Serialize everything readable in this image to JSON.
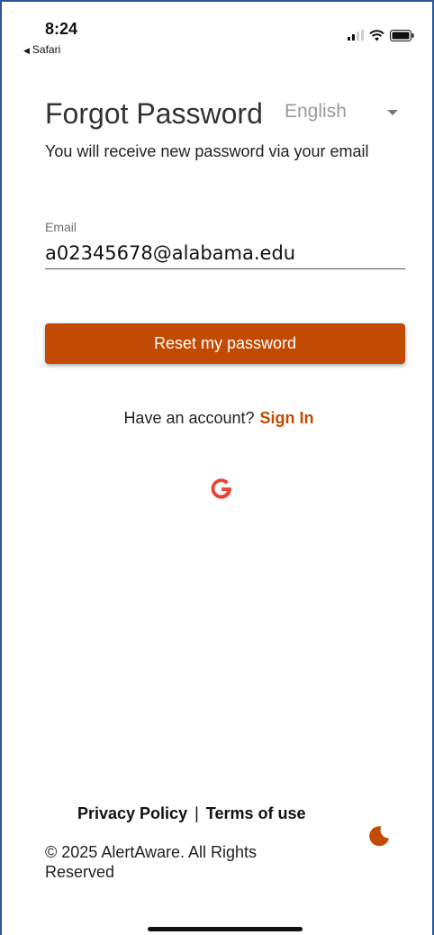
{
  "status_bar": {
    "time": "8:24",
    "back_app": "Safari"
  },
  "header": {
    "title": "Forgot Password",
    "language": "English",
    "subtitle": "You will receive new password via your email"
  },
  "form": {
    "email_label": "Email",
    "email_value": "a02345678@alabama.edu",
    "reset_button_label": "Reset my password"
  },
  "sign_in": {
    "prompt": "Have an account?",
    "link_label": "Sign In"
  },
  "social": {
    "google_icon": "google-icon"
  },
  "footer": {
    "privacy_label": "Privacy Policy",
    "separator": "|",
    "terms_label": "Terms of use",
    "copyright": "© 2025 AlertAware. All Rights Reserved",
    "theme_icon": "moon-icon"
  },
  "colors": {
    "accent": "#c24a02",
    "google_red": "#ea4335",
    "frame_border": "#2f5597"
  }
}
